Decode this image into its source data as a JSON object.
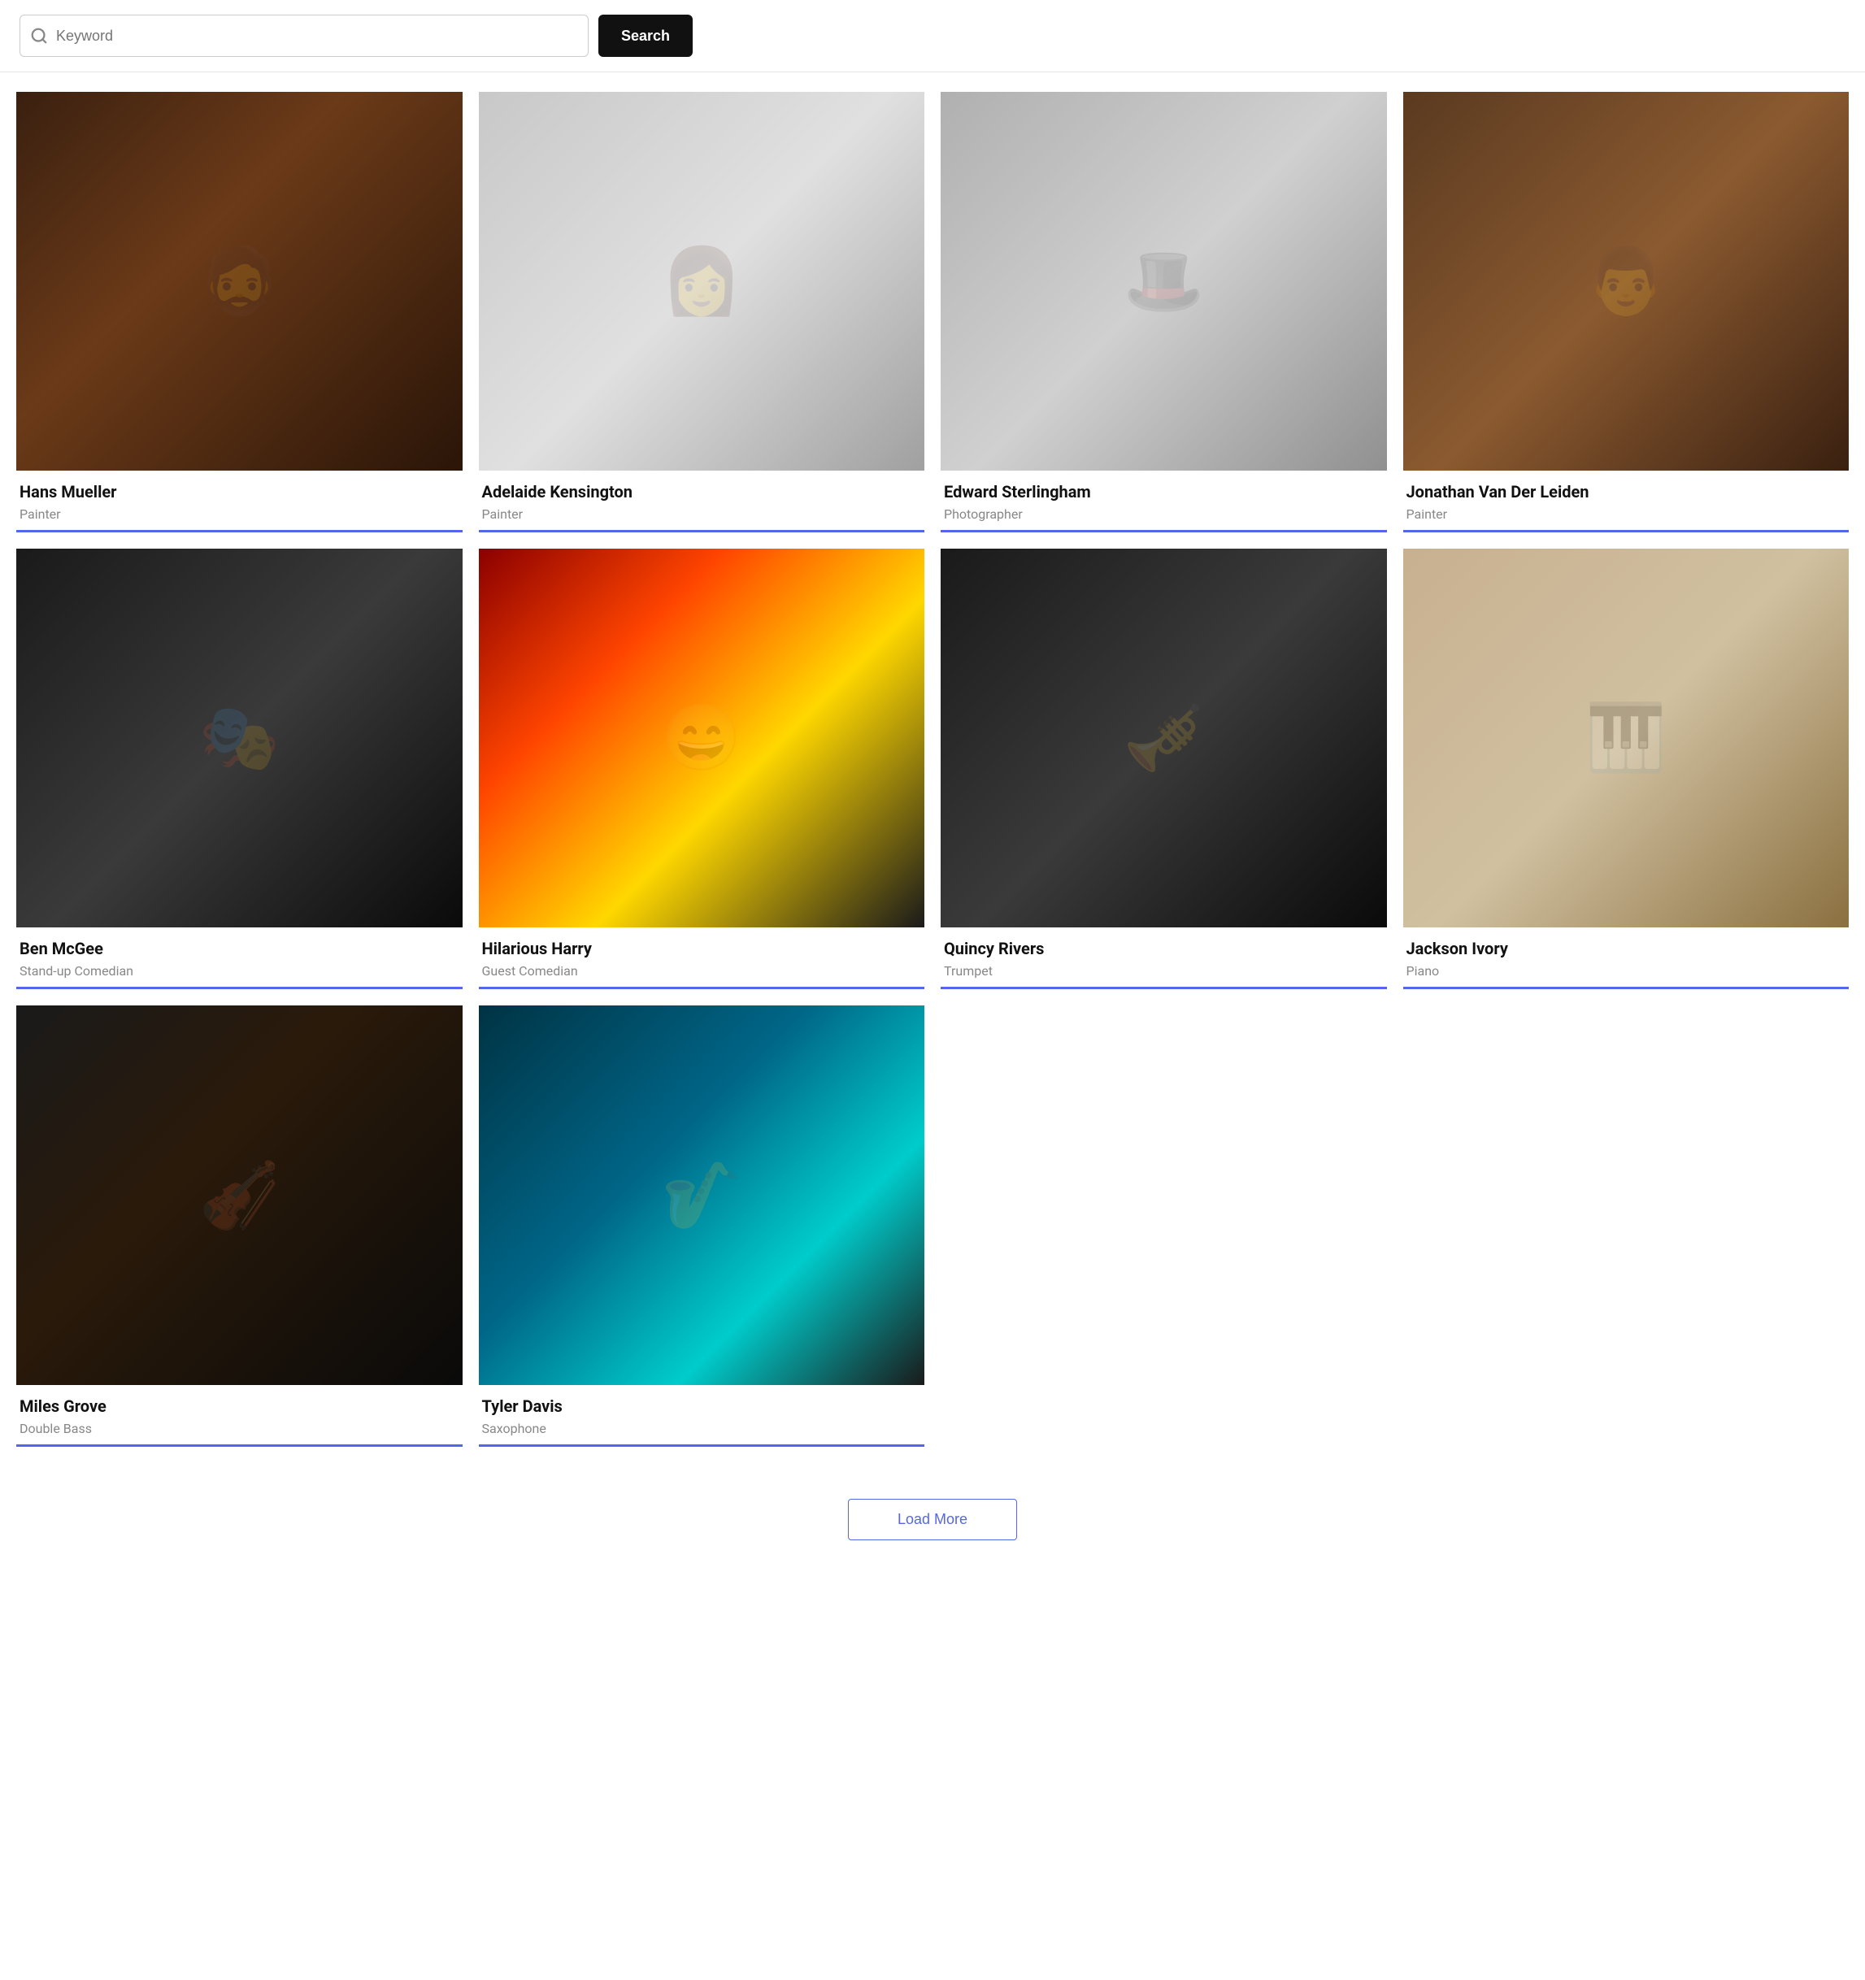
{
  "search": {
    "placeholder": "Keyword",
    "button_label": "Search"
  },
  "cards": [
    {
      "id": "hans-mueller",
      "name": "Hans Mueller",
      "role": "Painter",
      "img_class": "img-hans",
      "emoji": "🧔"
    },
    {
      "id": "adelaide-kensington",
      "name": "Adelaide Kensington",
      "role": "Painter",
      "img_class": "img-adelaide",
      "emoji": "👩"
    },
    {
      "id": "edward-sterlingham",
      "name": "Edward Sterlingham",
      "role": "Photographer",
      "img_class": "img-edward",
      "emoji": "🎩"
    },
    {
      "id": "jonathan-van-der-leiden",
      "name": "Jonathan Van Der Leiden",
      "role": "Painter",
      "img_class": "img-jonathan",
      "emoji": "👨"
    },
    {
      "id": "ben-mcgee",
      "name": "Ben McGee",
      "role": "Stand-up Comedian",
      "img_class": "img-ben",
      "emoji": "🎭"
    },
    {
      "id": "hilarious-harry",
      "name": "Hilarious Harry",
      "role": "Guest Comedian",
      "img_class": "img-harry",
      "emoji": "😄"
    },
    {
      "id": "quincy-rivers",
      "name": "Quincy Rivers",
      "role": "Trumpet",
      "img_class": "img-quincy",
      "emoji": "🎺"
    },
    {
      "id": "jackson-ivory",
      "name": "Jackson Ivory",
      "role": "Piano",
      "img_class": "img-jackson",
      "emoji": "🎹"
    },
    {
      "id": "miles-grove",
      "name": "Miles Grove",
      "role": "Double Bass",
      "img_class": "img-miles",
      "emoji": "🎻"
    },
    {
      "id": "tyler-davis",
      "name": "Tyler Davis",
      "role": "Saxophone",
      "img_class": "img-tyler",
      "emoji": "🎷"
    }
  ],
  "load_more": {
    "label": "Load More"
  }
}
